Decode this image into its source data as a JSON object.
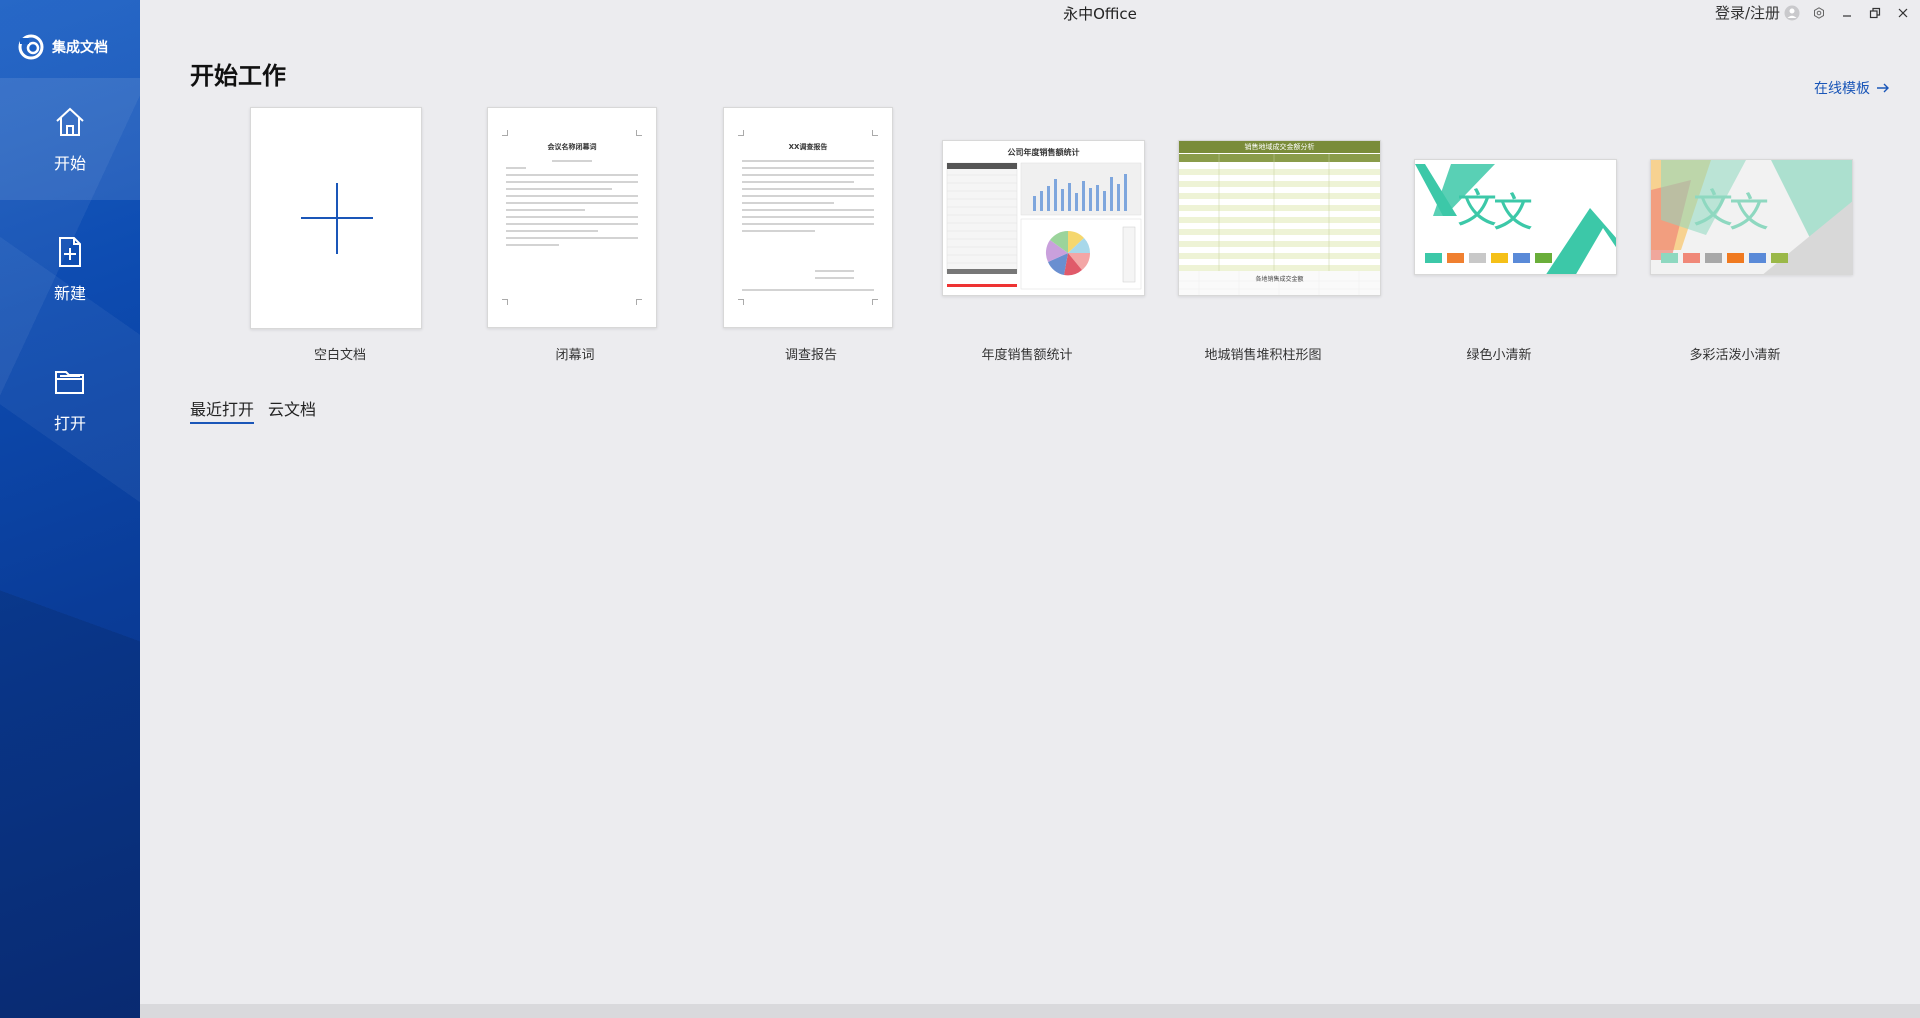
{
  "app": {
    "title": "永中Office",
    "brand_name": "集成文档"
  },
  "sidebar": {
    "items": [
      {
        "label": "开始",
        "icon": "home-icon"
      },
      {
        "label": "新建",
        "icon": "new-document-icon"
      },
      {
        "label": "打开",
        "icon": "folder-open-icon"
      }
    ]
  },
  "titlebar": {
    "login_label": "登录/注册"
  },
  "main": {
    "title": "开始工作",
    "online_templates_label": "在线模板",
    "templates": [
      {
        "label": "空白文档"
      },
      {
        "label": "闭幕词",
        "doc_title": "会议名称闭幕词"
      },
      {
        "label": "调查报告",
        "doc_title": "XX调查报告"
      },
      {
        "label": "年度销售额统计",
        "sheet_title": "公司年度销售额统计"
      },
      {
        "label": "地城销售堆积柱形图",
        "sheet_title": "销售地域成交金额分析",
        "sheet_footer": "各地销售成交金额"
      },
      {
        "label": "绿色小清新",
        "slide_text": "文"
      },
      {
        "label": "多彩活泼小清新",
        "slide_text": "文"
      }
    ],
    "tabs": [
      {
        "label": "最近打开",
        "active": true
      },
      {
        "label": "云文档",
        "active": false
      }
    ]
  },
  "colors": {
    "accent": "#1a56b8",
    "sidebar_top": "#1a5fc4",
    "sidebar_bottom": "#0a2f7e",
    "green_palette": [
      "#3cc8a8",
      "#f08030",
      "#c8c8c8",
      "#f5c018",
      "#5a8ad8",
      "#6aae3a"
    ],
    "colorful_palette": [
      "#8ed8c0",
      "#f08878",
      "#a8a8a8",
      "#f07a20",
      "#5a8ad8",
      "#9ab848"
    ]
  }
}
